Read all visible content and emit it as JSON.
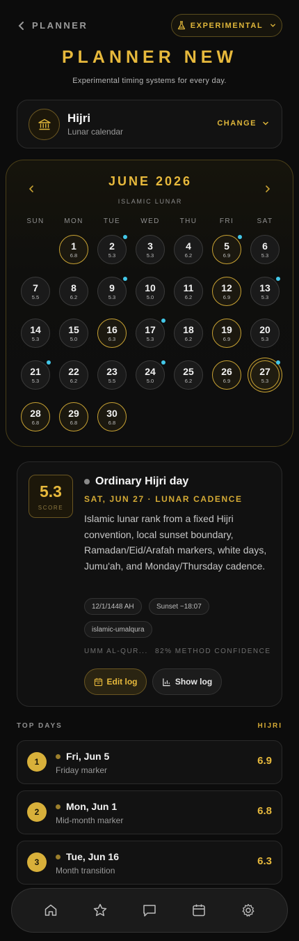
{
  "header": {
    "back_label": "PLANNER",
    "mode_label": "EXPERIMENTAL",
    "title": "PLANNER NEW",
    "subtitle": "Experimental timing systems for every day."
  },
  "calendar_system": {
    "name": "Hijri",
    "description": "Lunar calendar",
    "change_label": "CHANGE"
  },
  "calendar": {
    "month_title": "JUNE 2026",
    "subtitle": "ISLAMIC LUNAR",
    "weekdays": [
      "SUN",
      "MON",
      "TUE",
      "WED",
      "THU",
      "FRI",
      "SAT"
    ],
    "days": [
      {
        "day": "1",
        "score": "6.8",
        "highlight": true,
        "marker": false
      },
      {
        "day": "2",
        "score": "5.3",
        "highlight": false,
        "marker": true
      },
      {
        "day": "3",
        "score": "5.3",
        "highlight": false,
        "marker": false
      },
      {
        "day": "4",
        "score": "6.2",
        "highlight": false,
        "marker": false
      },
      {
        "day": "5",
        "score": "6.9",
        "highlight": true,
        "marker": true
      },
      {
        "day": "6",
        "score": "5.3",
        "highlight": false,
        "marker": false
      },
      {
        "day": "7",
        "score": "5.5",
        "highlight": false,
        "marker": false
      },
      {
        "day": "8",
        "score": "6.2",
        "highlight": false,
        "marker": false
      },
      {
        "day": "9",
        "score": "5.3",
        "highlight": false,
        "marker": true
      },
      {
        "day": "10",
        "score": "5.0",
        "highlight": false,
        "marker": false
      },
      {
        "day": "11",
        "score": "6.2",
        "highlight": false,
        "marker": false
      },
      {
        "day": "12",
        "score": "6.9",
        "highlight": true,
        "marker": false
      },
      {
        "day": "13",
        "score": "5.3",
        "highlight": false,
        "marker": true
      },
      {
        "day": "14",
        "score": "5.3",
        "highlight": false,
        "marker": false
      },
      {
        "day": "15",
        "score": "5.0",
        "highlight": false,
        "marker": false
      },
      {
        "day": "16",
        "score": "6.3",
        "highlight": true,
        "marker": false
      },
      {
        "day": "17",
        "score": "5.3",
        "highlight": false,
        "marker": true
      },
      {
        "day": "18",
        "score": "6.2",
        "highlight": false,
        "marker": false
      },
      {
        "day": "19",
        "score": "6.9",
        "highlight": true,
        "marker": false
      },
      {
        "day": "20",
        "score": "5.3",
        "highlight": false,
        "marker": false
      },
      {
        "day": "21",
        "score": "5.3",
        "highlight": false,
        "marker": true
      },
      {
        "day": "22",
        "score": "6.2",
        "highlight": false,
        "marker": false
      },
      {
        "day": "23",
        "score": "5.5",
        "highlight": false,
        "marker": false
      },
      {
        "day": "24",
        "score": "5.0",
        "highlight": false,
        "marker": true
      },
      {
        "day": "25",
        "score": "6.2",
        "highlight": false,
        "marker": false
      },
      {
        "day": "26",
        "score": "6.9",
        "highlight": true,
        "marker": false
      },
      {
        "day": "27",
        "score": "5.3",
        "highlight": false,
        "marker": true,
        "selected": true
      },
      {
        "day": "28",
        "score": "6.8",
        "highlight": true,
        "marker": false
      },
      {
        "day": "29",
        "score": "6.8",
        "highlight": true,
        "marker": false
      },
      {
        "day": "30",
        "score": "6.8",
        "highlight": true,
        "marker": false
      }
    ],
    "first_weekday_index": 1,
    "marker_color": "#43c7e8",
    "accent_color": "#e7b93c"
  },
  "detail": {
    "score": "5.3",
    "score_label": "SCORE",
    "title": "Ordinary Hijri day",
    "date_line": "SAT, JUN 27 · LUNAR CADENCE",
    "description": "Islamic lunar rank from a fixed Hijri convention, local sunset boundary, Ramadan/Eid/Arafah markers, white days, Jumu'ah, and Monday/Thursday cadence.",
    "chips": [
      "12/1/1448 AH",
      "Sunset ~18:07",
      "islamic-umalqura"
    ],
    "method": "UMM AL-QUR...",
    "confidence": "82% METHOD CONFIDENCE",
    "edit_label": "Edit log",
    "show_label": "Show log"
  },
  "top_days": {
    "label": "TOP DAYS",
    "system": "HIJRI",
    "items": [
      {
        "rank": "1",
        "date": "Fri, Jun 5",
        "note": "Friday marker",
        "score": "6.9"
      },
      {
        "rank": "2",
        "date": "Mon, Jun 1",
        "note": "Mid-month marker",
        "score": "6.8"
      },
      {
        "rank": "3",
        "date": "Tue, Jun 16",
        "note": "Month transition",
        "score": "6.3"
      }
    ]
  },
  "nav": {
    "items": [
      "home-icon",
      "star-icon",
      "chat-icon",
      "calendar-icon",
      "settings-icon"
    ]
  }
}
